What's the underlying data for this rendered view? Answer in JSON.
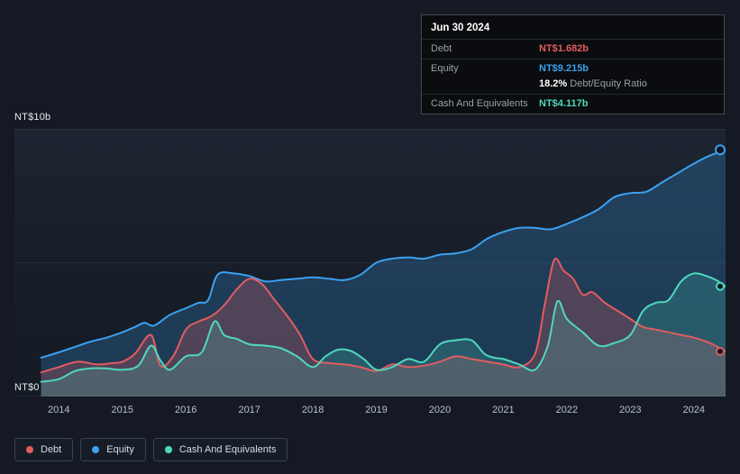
{
  "tooltip": {
    "date": "Jun 30 2024",
    "debt_label": "Debt",
    "debt_value": "NT$1.682b",
    "equity_label": "Equity",
    "equity_value": "NT$9.215b",
    "ratio_value": "18.2%",
    "ratio_label": "Debt/Equity Ratio",
    "cash_label": "Cash And Equivalents",
    "cash_value": "NT$4.117b"
  },
  "axis": {
    "y_top_label": "NT$10b",
    "y_bottom_label": "NT$0"
  },
  "legend": {
    "items": [
      {
        "label": "Debt",
        "color": "#e25c60"
      },
      {
        "label": "Equity",
        "color": "#3ba1f0"
      },
      {
        "label": "Cash And Equivalents",
        "color": "#4fd8bd"
      }
    ]
  },
  "chart_data": {
    "type": "area",
    "unit": "NT$ billions",
    "x_ticks": [
      "2014",
      "2015",
      "2016",
      "2017",
      "2018",
      "2019",
      "2020",
      "2021",
      "2022",
      "2023",
      "2024"
    ],
    "x_range": [
      2013.3,
      2024.5
    ],
    "ylim": [
      0,
      10
    ],
    "y_gridlines": [
      0,
      5,
      10
    ],
    "series": [
      {
        "name": "Equity",
        "color": "#3ba1f0",
        "fill": "rgba(59,158,240,0.24)",
        "points": [
          [
            2013.72,
            1.45
          ],
          [
            2014.0,
            1.65
          ],
          [
            2014.25,
            1.85
          ],
          [
            2014.5,
            2.05
          ],
          [
            2014.75,
            2.2
          ],
          [
            2015.0,
            2.4
          ],
          [
            2015.2,
            2.6
          ],
          [
            2015.35,
            2.75
          ],
          [
            2015.5,
            2.65
          ],
          [
            2015.75,
            3.05
          ],
          [
            2016.0,
            3.3
          ],
          [
            2016.2,
            3.5
          ],
          [
            2016.35,
            3.6
          ],
          [
            2016.5,
            4.55
          ],
          [
            2016.75,
            4.6
          ],
          [
            2017.0,
            4.5
          ],
          [
            2017.25,
            4.3
          ],
          [
            2017.5,
            4.35
          ],
          [
            2017.75,
            4.4
          ],
          [
            2018.0,
            4.45
          ],
          [
            2018.25,
            4.4
          ],
          [
            2018.5,
            4.35
          ],
          [
            2018.75,
            4.55
          ],
          [
            2019.0,
            5.0
          ],
          [
            2019.25,
            5.15
          ],
          [
            2019.5,
            5.2
          ],
          [
            2019.75,
            5.15
          ],
          [
            2020.0,
            5.3
          ],
          [
            2020.25,
            5.35
          ],
          [
            2020.5,
            5.5
          ],
          [
            2020.75,
            5.9
          ],
          [
            2021.0,
            6.15
          ],
          [
            2021.25,
            6.3
          ],
          [
            2021.5,
            6.3
          ],
          [
            2021.75,
            6.25
          ],
          [
            2022.0,
            6.45
          ],
          [
            2022.25,
            6.7
          ],
          [
            2022.5,
            7.0
          ],
          [
            2022.75,
            7.45
          ],
          [
            2023.0,
            7.6
          ],
          [
            2023.25,
            7.65
          ],
          [
            2023.5,
            8.0
          ],
          [
            2023.75,
            8.35
          ],
          [
            2024.0,
            8.7
          ],
          [
            2024.25,
            9.0
          ],
          [
            2024.5,
            9.215
          ]
        ]
      },
      {
        "name": "Debt",
        "color": "#e25c60",
        "fill": "rgba(226,92,96,0.26)",
        "points": [
          [
            2013.72,
            0.9
          ],
          [
            2014.0,
            1.1
          ],
          [
            2014.3,
            1.3
          ],
          [
            2014.6,
            1.2
          ],
          [
            2014.85,
            1.25
          ],
          [
            2015.0,
            1.3
          ],
          [
            2015.2,
            1.6
          ],
          [
            2015.45,
            2.3
          ],
          [
            2015.6,
            1.15
          ],
          [
            2015.8,
            1.5
          ],
          [
            2016.0,
            2.5
          ],
          [
            2016.2,
            2.8
          ],
          [
            2016.4,
            3.0
          ],
          [
            2016.6,
            3.4
          ],
          [
            2016.8,
            4.0
          ],
          [
            2017.0,
            4.4
          ],
          [
            2017.2,
            4.2
          ],
          [
            2017.4,
            3.6
          ],
          [
            2017.6,
            3.0
          ],
          [
            2017.8,
            2.3
          ],
          [
            2018.0,
            1.4
          ],
          [
            2018.25,
            1.25
          ],
          [
            2018.5,
            1.2
          ],
          [
            2018.75,
            1.1
          ],
          [
            2019.0,
            0.95
          ],
          [
            2019.25,
            1.2
          ],
          [
            2019.5,
            1.1
          ],
          [
            2019.75,
            1.15
          ],
          [
            2020.0,
            1.3
          ],
          [
            2020.25,
            1.5
          ],
          [
            2020.5,
            1.4
          ],
          [
            2020.75,
            1.3
          ],
          [
            2021.0,
            1.2
          ],
          [
            2021.25,
            1.1
          ],
          [
            2021.5,
            1.6
          ],
          [
            2021.65,
            3.4
          ],
          [
            2021.8,
            5.1
          ],
          [
            2021.95,
            4.7
          ],
          [
            2022.1,
            4.4
          ],
          [
            2022.25,
            3.8
          ],
          [
            2022.4,
            3.9
          ],
          [
            2022.6,
            3.5
          ],
          [
            2022.8,
            3.2
          ],
          [
            2023.0,
            2.9
          ],
          [
            2023.2,
            2.6
          ],
          [
            2023.4,
            2.5
          ],
          [
            2023.6,
            2.4
          ],
          [
            2023.8,
            2.3
          ],
          [
            2024.0,
            2.2
          ],
          [
            2024.25,
            2.0
          ],
          [
            2024.5,
            1.682
          ]
        ]
      },
      {
        "name": "Cash And Equivalents",
        "color": "#4fd8bd",
        "fill": "rgba(79,216,189,0.20)",
        "points": [
          [
            2013.72,
            0.55
          ],
          [
            2014.0,
            0.65
          ],
          [
            2014.25,
            0.95
          ],
          [
            2014.5,
            1.05
          ],
          [
            2014.75,
            1.05
          ],
          [
            2015.0,
            1.0
          ],
          [
            2015.25,
            1.15
          ],
          [
            2015.45,
            1.9
          ],
          [
            2015.6,
            1.35
          ],
          [
            2015.75,
            1.0
          ],
          [
            2016.0,
            1.5
          ],
          [
            2016.25,
            1.65
          ],
          [
            2016.45,
            2.8
          ],
          [
            2016.6,
            2.3
          ],
          [
            2016.8,
            2.15
          ],
          [
            2017.0,
            1.95
          ],
          [
            2017.25,
            1.9
          ],
          [
            2017.5,
            1.8
          ],
          [
            2017.75,
            1.5
          ],
          [
            2018.0,
            1.1
          ],
          [
            2018.2,
            1.5
          ],
          [
            2018.4,
            1.75
          ],
          [
            2018.6,
            1.7
          ],
          [
            2018.8,
            1.4
          ],
          [
            2019.0,
            1.0
          ],
          [
            2019.25,
            1.1
          ],
          [
            2019.5,
            1.4
          ],
          [
            2019.75,
            1.3
          ],
          [
            2020.0,
            1.95
          ],
          [
            2020.25,
            2.1
          ],
          [
            2020.5,
            2.1
          ],
          [
            2020.7,
            1.6
          ],
          [
            2020.85,
            1.45
          ],
          [
            2021.0,
            1.4
          ],
          [
            2021.25,
            1.2
          ],
          [
            2021.5,
            1.0
          ],
          [
            2021.7,
            1.9
          ],
          [
            2021.85,
            3.55
          ],
          [
            2022.0,
            2.9
          ],
          [
            2022.25,
            2.4
          ],
          [
            2022.5,
            1.9
          ],
          [
            2022.75,
            2.0
          ],
          [
            2023.0,
            2.3
          ],
          [
            2023.2,
            3.2
          ],
          [
            2023.4,
            3.5
          ],
          [
            2023.6,
            3.6
          ],
          [
            2023.8,
            4.3
          ],
          [
            2024.0,
            4.6
          ],
          [
            2024.2,
            4.5
          ],
          [
            2024.35,
            4.35
          ],
          [
            2024.5,
            4.117
          ]
        ]
      }
    ]
  }
}
